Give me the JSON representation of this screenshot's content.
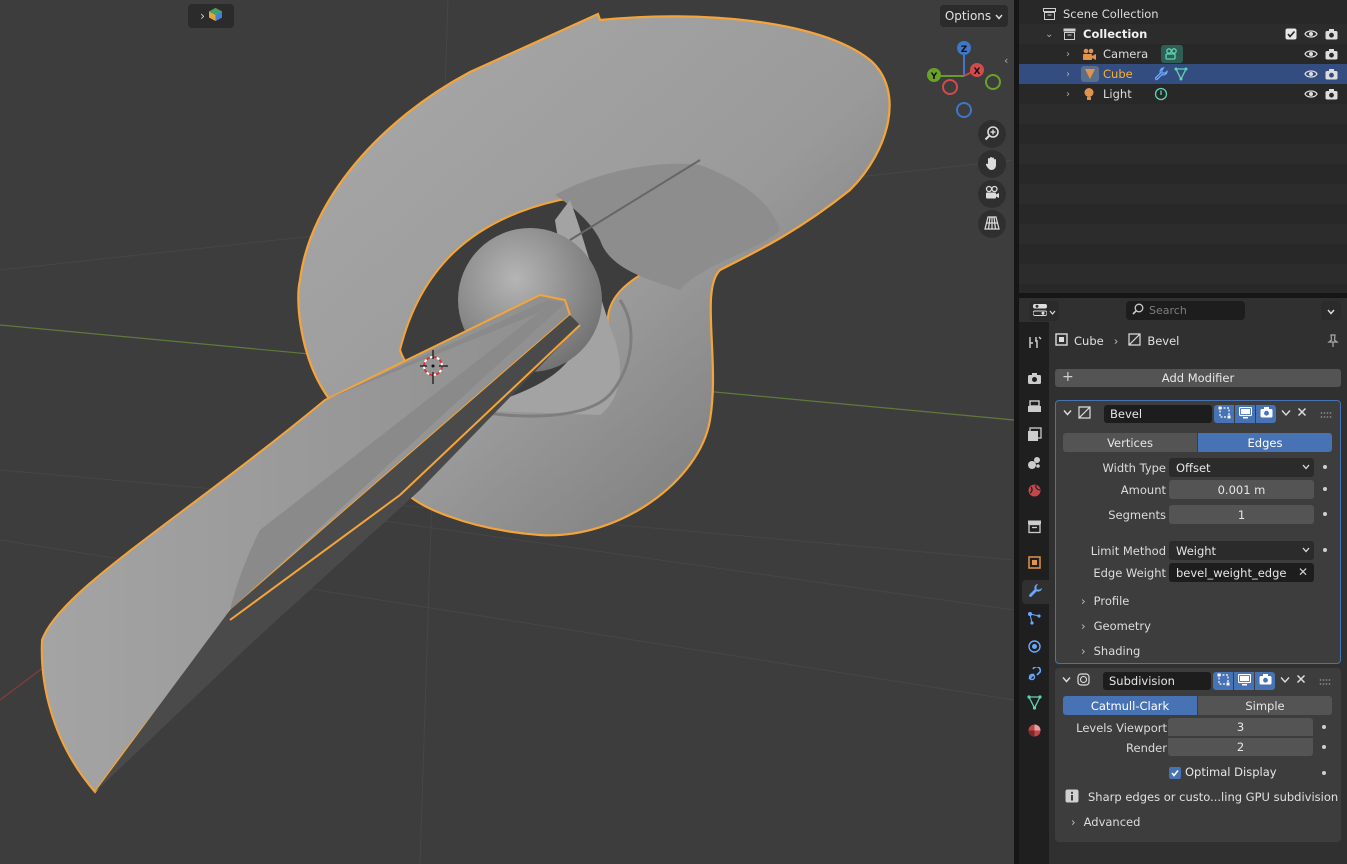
{
  "viewport": {
    "options_label": "Options",
    "gizmo": {
      "z": "Z",
      "y": "Y",
      "x": "X"
    }
  },
  "outliner": {
    "scene_collection": "Scene Collection",
    "collection": "Collection",
    "items": [
      {
        "label": "Camera"
      },
      {
        "label": "Cube"
      },
      {
        "label": "Light"
      }
    ]
  },
  "properties": {
    "search_placeholder": "Search",
    "breadcrumb": {
      "object": "Cube",
      "modifier": "Bevel"
    },
    "add_modifier": "Add Modifier",
    "bevel": {
      "name": "Bevel",
      "affect_options": [
        "Vertices",
        "Edges"
      ],
      "affect_selected": "Edges",
      "width_type_label": "Width Type",
      "width_type_value": "Offset",
      "amount_label": "Amount",
      "amount_value": "0.001 m",
      "segments_label": "Segments",
      "segments_value": "1",
      "limit_method_label": "Limit Method",
      "limit_method_value": "Weight",
      "edge_weight_label": "Edge Weight",
      "edge_weight_value": "bevel_weight_edge",
      "subpanels": [
        "Profile",
        "Geometry",
        "Shading"
      ]
    },
    "subdivision": {
      "name": "Subdivision",
      "mode_options": [
        "Catmull-Clark",
        "Simple"
      ],
      "mode_selected": "Catmull-Clark",
      "levels_viewport_label": "Levels Viewport",
      "levels_viewport_value": "3",
      "render_label": "Render",
      "render_value": "2",
      "optimal_display_label": "Optimal Display",
      "optimal_display_checked": true,
      "info_text": "Sharp edges or custo...ling GPU subdivision",
      "advanced_label": "Advanced"
    }
  },
  "colors": {
    "selection_outline": "#f5a43a",
    "accent_blue": "#4772b3",
    "selected_row": "#334d80"
  }
}
